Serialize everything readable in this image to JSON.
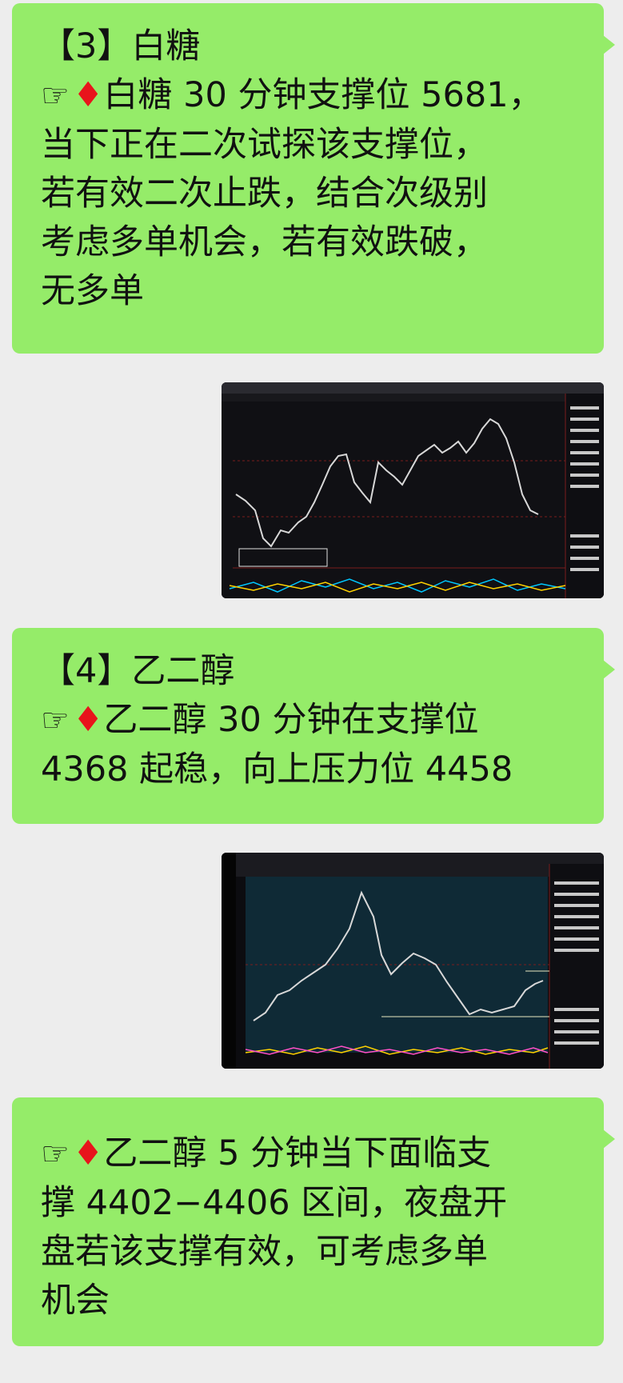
{
  "messages": [
    {
      "title": "【3】白糖",
      "icon_hand": "pointing-hand-icon",
      "icon_diamond": "red-diamond-icon",
      "lines": [
        "白糖 30 分钟支撑位 5681，",
        "当下正在二次试探该支撑位，",
        "若有效二次止跌，结合次级别",
        "考虑多单机会，若有效跌破，",
        "无多单"
      ]
    },
    {
      "title": "【4】乙二醇",
      "lines": [
        "乙二醇 30 分钟在支撑位",
        "4368 起稳，向上压力位 4458"
      ]
    },
    {
      "lines": [
        "乙二醇 5 分钟当下面临支",
        "撑 4402−4406 区间，夜盘开",
        "盘若该支撑有效，可考虑多单",
        "机会"
      ]
    }
  ],
  "images": {
    "chart1_alt": "白糖 30分钟 K线截图",
    "chart2_alt": "乙二醇 30分钟 K线截图"
  },
  "colors": {
    "bubble": "#95ec69",
    "background": "#ededed",
    "diamond": "#e8141b"
  }
}
